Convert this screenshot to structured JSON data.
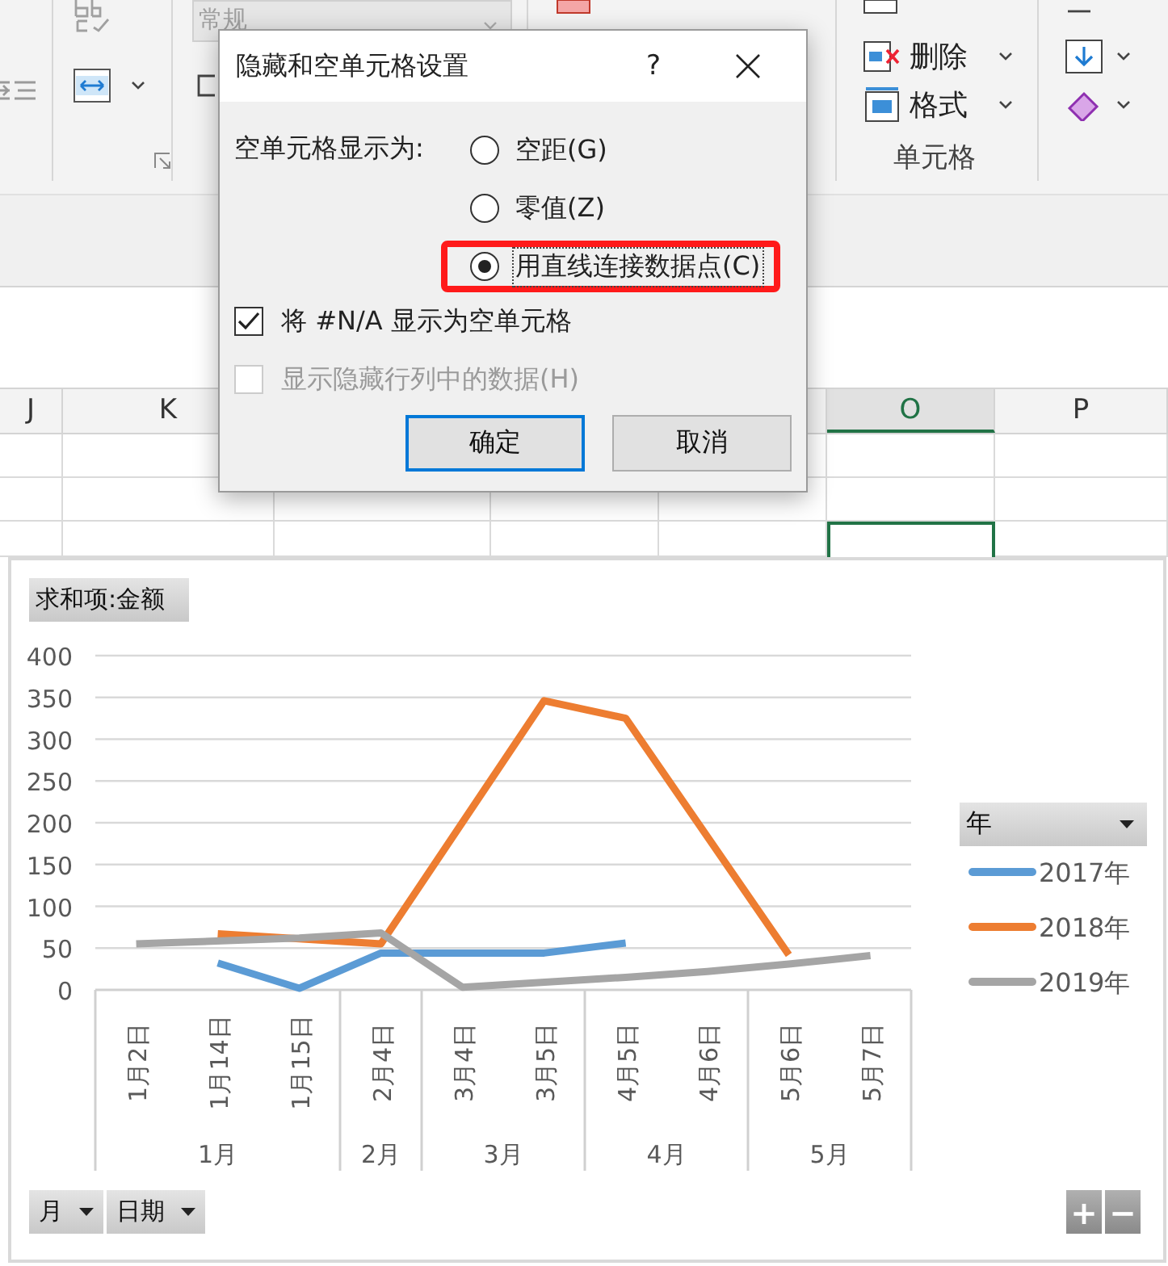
{
  "ribbon": {
    "number_format": "常规",
    "cells_group": {
      "items": [
        {
          "label": "删除"
        },
        {
          "label": "格式"
        }
      ],
      "title": "单元格"
    }
  },
  "column_headers": [
    {
      "label": "J",
      "selected": false
    },
    {
      "label": "K",
      "selected": false
    },
    {
      "label": "O",
      "selected": true
    },
    {
      "label": "P",
      "selected": false
    }
  ],
  "dialog": {
    "title": "隐藏和空单元格设置",
    "help": "?",
    "prompt": "空单元格显示为:",
    "options": [
      {
        "label": "空距(G)",
        "selected": false,
        "highlighted": false
      },
      {
        "label": "零值(Z)",
        "selected": false,
        "highlighted": false
      },
      {
        "label": "用直线连接数据点(C)",
        "selected": true,
        "highlighted": true
      }
    ],
    "checkboxes": [
      {
        "label": "将 #N/A 显示为空单元格",
        "checked": true,
        "disabled": false
      },
      {
        "label": "显示隐藏行列中的数据(H)",
        "checked": false,
        "disabled": true
      }
    ],
    "buttons": [
      {
        "label": "确定",
        "default": true
      },
      {
        "label": "取消",
        "default": false
      }
    ]
  },
  "chart": {
    "value_field": "求和项:金额",
    "legend_field": "年",
    "axis_fields": [
      "月",
      "日期"
    ],
    "zoom_buttons": [
      "+",
      "−"
    ],
    "months": [
      {
        "label": "1月"
      },
      {
        "label": "2月"
      },
      {
        "label": "3月"
      },
      {
        "label": "4月"
      },
      {
        "label": "5月"
      }
    ],
    "chart_data": {
      "type": "line",
      "categories": [
        "1月2日",
        "1月14日",
        "1月15日",
        "2月4日",
        "3月4日",
        "3月5日",
        "4月5日",
        "4月6日",
        "5月6日",
        "5月7日"
      ],
      "ylim": [
        0,
        400
      ],
      "grid": true,
      "legend": true,
      "yticks": [
        0,
        50,
        100,
        150,
        200,
        250,
        300,
        350,
        400
      ],
      "series": [
        {
          "name": "2017年",
          "color": "#5b9bd5",
          "values": [
            null,
            32,
            2,
            44,
            null,
            44,
            56,
            null,
            null,
            null
          ]
        },
        {
          "name": "2018年",
          "color": "#ed7d31",
          "values": [
            null,
            67,
            null,
            55,
            null,
            346,
            325,
            null,
            42,
            null
          ]
        },
        {
          "name": "2019年",
          "color": "#a5a5a5",
          "values": [
            55,
            null,
            62,
            68,
            3,
            null,
            15,
            22,
            31,
            41
          ]
        }
      ]
    }
  }
}
